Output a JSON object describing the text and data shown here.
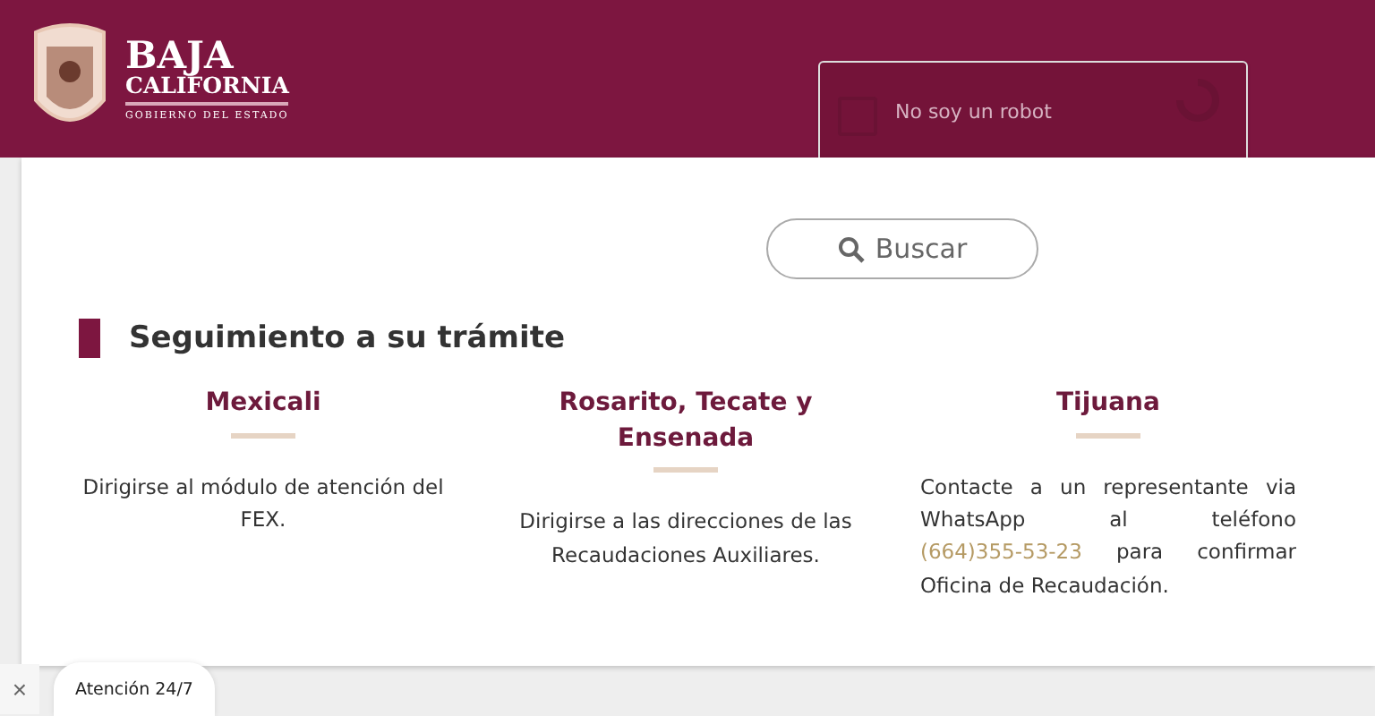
{
  "header": {
    "logo_title": "BAJA",
    "logo_subtitle": "CALIFORNIA",
    "logo_tagline": "GOBIERNO DEL ESTADO"
  },
  "captcha": {
    "label": "No soy un robot",
    "checked": false
  },
  "search_button": {
    "label": "Buscar"
  },
  "section": {
    "title": "Seguimiento a su trámite",
    "columns": [
      {
        "heading": "Mexicali",
        "parts": [
          {
            "kind": "text",
            "text": "Dirigirse al módulo de atención del FEX."
          }
        ]
      },
      {
        "heading": "Rosarito, Tecate y Ensenada",
        "parts": [
          {
            "kind": "text",
            "text": "Dirigirse a las direcciones de las Recaudaciones Auxiliares."
          }
        ]
      },
      {
        "heading": "Tijuana",
        "parts": [
          {
            "kind": "text",
            "text": "Contacte a un representante via WhatsApp al teléfono "
          },
          {
            "kind": "phone",
            "text": "(664)355-53-23"
          },
          {
            "kind": "text",
            "text": " para confirmar Oficina de Recaudación."
          }
        ]
      }
    ]
  },
  "chat": {
    "close": "×",
    "label": "Atención 24/7"
  }
}
